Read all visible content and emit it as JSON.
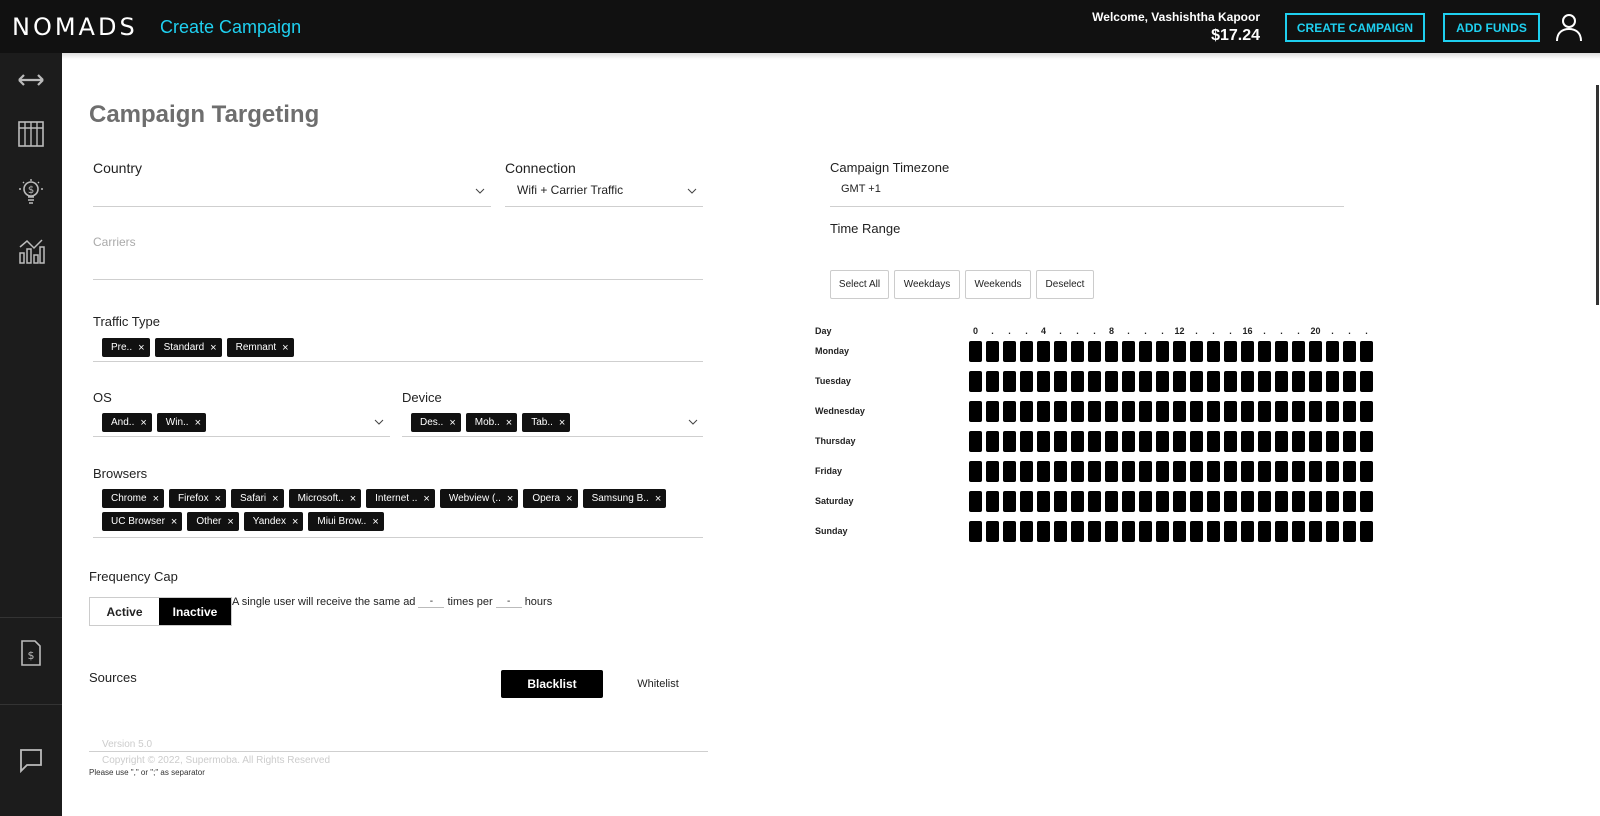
{
  "header": {
    "logo": "NOMADS",
    "page_title": "Create Campaign",
    "welcome": "Welcome, Vashishtha Kapoor",
    "balance": "$17.24",
    "create_campaign_label": "CREATE CAMPAIGN",
    "add_funds_label": "ADD FUNDS",
    "accent_color": "#1fd0f0"
  },
  "sidebar": {
    "items": [
      "expand-icon",
      "campaigns-table-icon",
      "bulb-dollar-icon",
      "analytics-chart-icon",
      "invoice-icon",
      "chat-icon"
    ]
  },
  "main": {
    "title": "Campaign Targeting",
    "country": {
      "label": "Country",
      "value": ""
    },
    "connection": {
      "label": "Connection",
      "value": "Wifi + Carrier Traffic"
    },
    "carriers": {
      "label": "Carriers"
    },
    "traffic_type": {
      "label": "Traffic Type",
      "tags": [
        "Pre..",
        "Standard",
        "Remnant"
      ]
    },
    "os": {
      "label": "OS",
      "tags": [
        "And..",
        "Win.."
      ]
    },
    "device": {
      "label": "Device",
      "tags": [
        "Des..",
        "Mob..",
        "Tab.."
      ]
    },
    "browsers": {
      "label": "Browsers",
      "tags": [
        "Chrome",
        "Firefox",
        "Safari",
        "Microsoft..",
        "Internet ..",
        "Webview (..",
        "Opera",
        "Samsung B..",
        "UC Browser",
        "Other",
        "Yandex",
        "Miui Brow.."
      ]
    },
    "frequency_cap": {
      "label": "Frequency Cap",
      "active_label": "Active",
      "inactive_label": "Inactive",
      "selected": "Inactive",
      "text_before": "A single user will receive the same ad",
      "times_value": "-",
      "text_middle": "times per",
      "hours_value": "-",
      "text_after": "hours"
    },
    "sources": {
      "label": "Sources",
      "blacklist_label": "Blacklist",
      "whitelist_label": "Whitelist",
      "selected": "Blacklist",
      "separator_hint": "Please use \",\" or \";\" as separator"
    },
    "footer": {
      "version": "Version 5.0",
      "copyright": "Copyright © 2022, Supermoba. All Rights Reserved"
    },
    "timezone": {
      "label": "Campaign Timezone",
      "value": "GMT +1"
    },
    "time_range": {
      "label": "Time Range",
      "buttons": [
        "Select All",
        "Weekdays",
        "Weekends",
        "Deselect"
      ],
      "day_header": "Day",
      "hour_labels": [
        "0",
        ".",
        ".",
        ".",
        "4",
        ".",
        ".",
        ".",
        "8",
        ".",
        ".",
        ".",
        "12",
        ".",
        ".",
        ".",
        "16",
        ".",
        ".",
        ".",
        "20",
        ".",
        ".",
        "."
      ],
      "days": [
        "Monday",
        "Tuesday",
        "Wednesday",
        "Thursday",
        "Friday",
        "Saturday",
        "Sunday"
      ],
      "all_hours_selected": true
    }
  }
}
